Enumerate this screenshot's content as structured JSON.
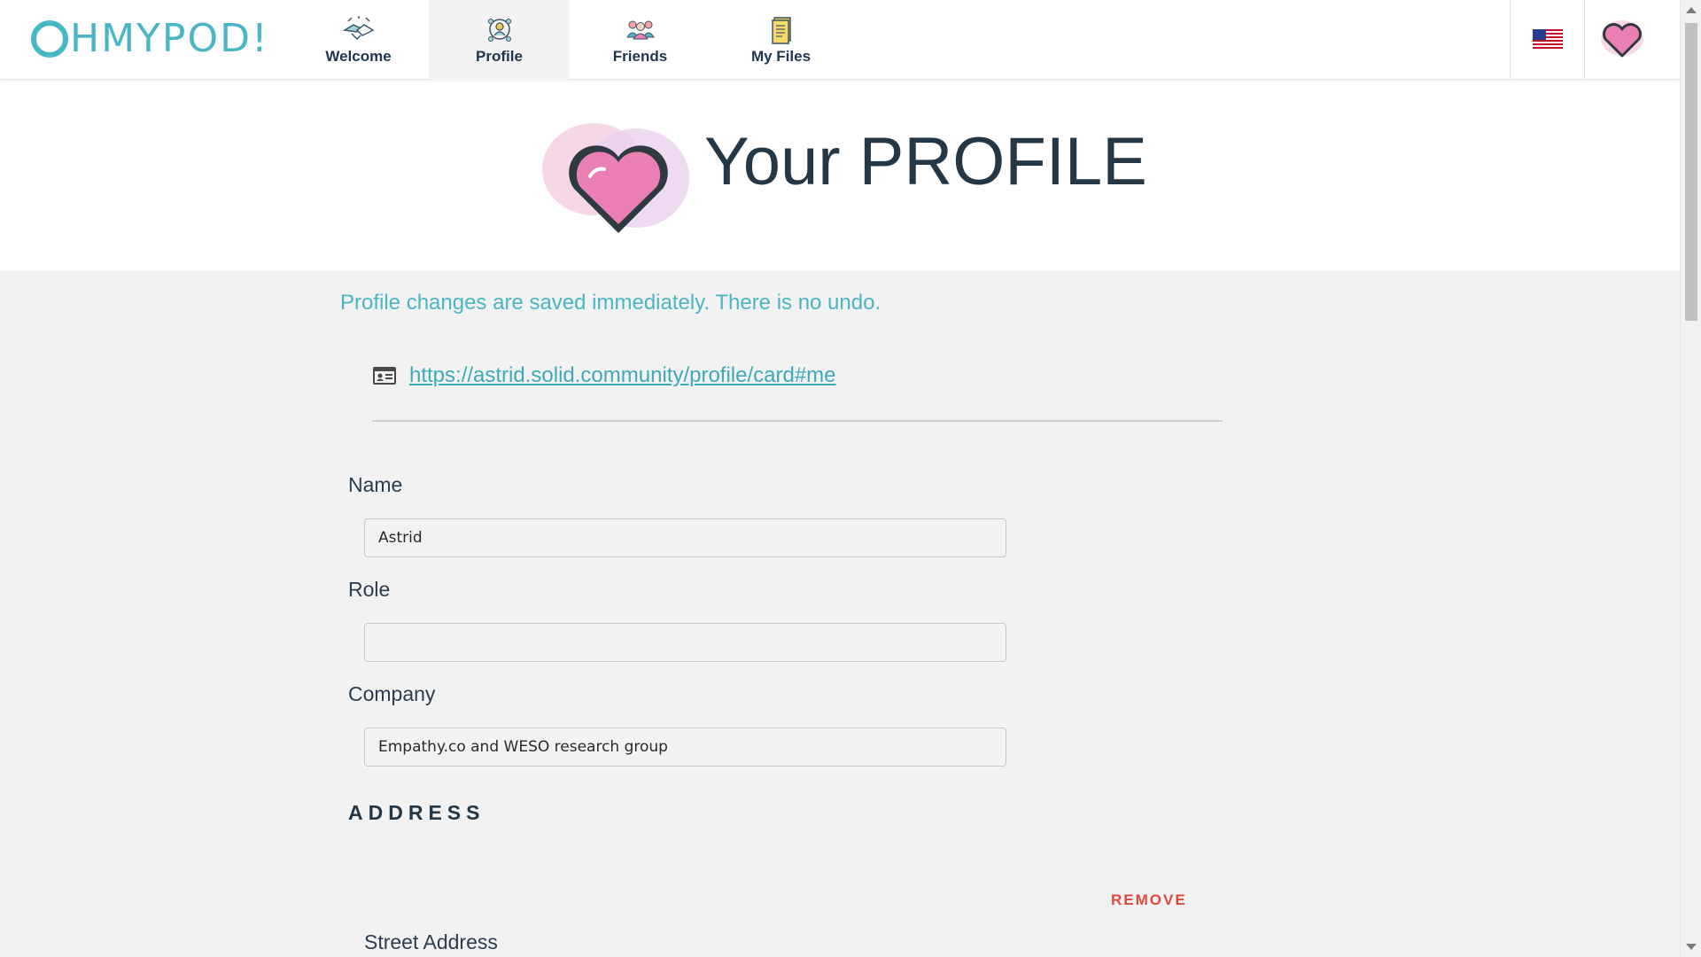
{
  "brand": {
    "logo_text": "HMYPOD!",
    "accent_color": "#4ab5c4"
  },
  "nav": {
    "items": [
      {
        "label": "Welcome",
        "icon": "handshake-icon"
      },
      {
        "label": "Profile",
        "icon": "profile-network-icon",
        "active": true
      },
      {
        "label": "Friends",
        "icon": "friends-group-icon"
      },
      {
        "label": "My Files",
        "icon": "files-icon"
      }
    ]
  },
  "header_right": {
    "language_icon": "us-flag-icon",
    "user_icon": "heart-avatar-icon"
  },
  "hero": {
    "title": "Your PROFILE",
    "icon": "heart-icon"
  },
  "profile": {
    "notice": "Profile changes are saved immediately. There is no undo.",
    "webid": "https://astrid.solid.community/profile/card#me",
    "webid_icon": "id-card-icon",
    "fields": {
      "name": {
        "label": "Name",
        "value": "Astrid"
      },
      "role": {
        "label": "Role",
        "value": ""
      },
      "company": {
        "label": "Company",
        "value": "Empathy.co and WESO research group"
      }
    },
    "address": {
      "title": "ADDRESS",
      "remove_label": "REMOVE",
      "street_label": "Street Address"
    }
  },
  "colors": {
    "link": "#3ea9bb",
    "danger": "#e0473c",
    "heading": "#243746",
    "heart_pink": "#e97fb3"
  }
}
